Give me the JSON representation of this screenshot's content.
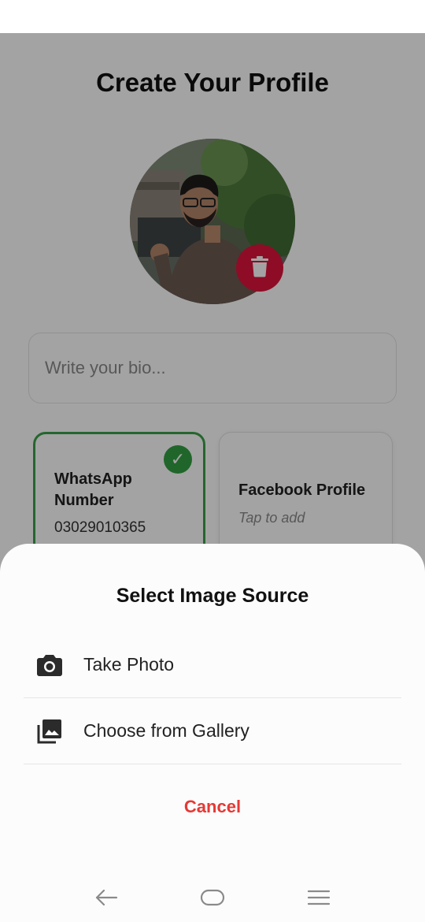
{
  "page": {
    "title": "Create Your Profile",
    "bio": {
      "placeholder": "Write your bio...",
      "value": ""
    },
    "contact_cards": [
      {
        "title": "WhatsApp Number",
        "value": "03029010365",
        "selected": true,
        "badge_icon": "check-icon"
      },
      {
        "title": "Facebook Profile",
        "subtitle": "Tap to add",
        "selected": false
      }
    ]
  },
  "bottom_sheet": {
    "title": "Select Image Source",
    "options": [
      {
        "label": "Take Photo",
        "icon": "camera-icon"
      },
      {
        "label": "Choose from Gallery",
        "icon": "gallery-icon"
      }
    ],
    "cancel_label": "Cancel"
  },
  "navigation": {
    "buttons": [
      "back-icon",
      "home-icon",
      "menu-icon"
    ]
  },
  "colors": {
    "accent_green": "#33a043",
    "delete_red": "#e0143c",
    "cancel_red": "#e53935"
  }
}
